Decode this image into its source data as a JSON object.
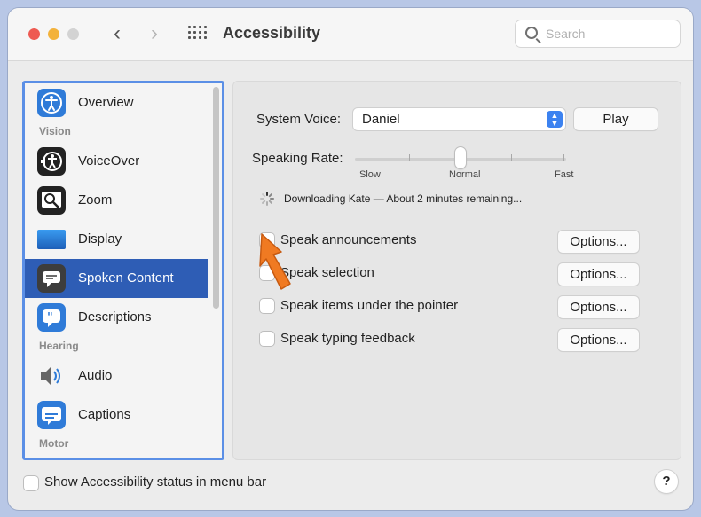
{
  "window": {
    "title": "Accessibility"
  },
  "search": {
    "placeholder": "Search"
  },
  "sidebar": {
    "items": [
      {
        "label": "Overview"
      },
      {
        "label": "VoiceOver"
      },
      {
        "label": "Zoom"
      },
      {
        "label": "Display"
      },
      {
        "label": "Spoken Content"
      },
      {
        "label": "Descriptions"
      },
      {
        "label": "Audio"
      },
      {
        "label": "Captions"
      }
    ],
    "sections": {
      "vision": "Vision",
      "hearing": "Hearing",
      "motor": "Motor"
    },
    "selected": "Spoken Content"
  },
  "content": {
    "system_voice_label": "System Voice:",
    "system_voice_value": "Daniel",
    "play_label": "Play",
    "speaking_rate_label": "Speaking Rate:",
    "rate_slow": "Slow",
    "rate_normal": "Normal",
    "rate_fast": "Fast",
    "speaking_rate_value": 0.5,
    "download_status": "Downloading Kate — About 2 minutes remaining...",
    "options": [
      {
        "label": "Speak announcements",
        "checked": false,
        "button": "Options..."
      },
      {
        "label": "Speak selection",
        "checked": false,
        "button": "Options..."
      },
      {
        "label": "Speak items under the pointer",
        "checked": false,
        "button": "Options..."
      },
      {
        "label": "Speak typing feedback",
        "checked": false,
        "button": "Options..."
      }
    ]
  },
  "footer": {
    "status_menu_label": "Show Accessibility status in menu bar",
    "status_menu_checked": false,
    "help_label": "?"
  },
  "colors": {
    "accent": "#2e5db5",
    "highlight_border": "#5b8fe6",
    "arrow": "#f07a22"
  }
}
